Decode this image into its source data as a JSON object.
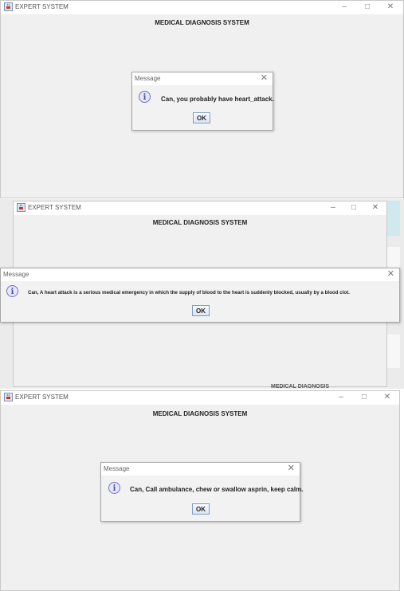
{
  "app": {
    "window_title": "EXPERT SYSTEM",
    "heading": "MEDICAL DIAGNOSIS SYSTEM",
    "controls": {
      "minimize": "–",
      "maximize": "□",
      "close": "✕"
    },
    "icon": "java-cup-icon"
  },
  "panels": [
    {
      "dialog_title": "Message",
      "message": "Can, you probably have heart_attack.",
      "ok_label": "OK",
      "icon": "info-icon"
    },
    {
      "dialog_title": "Message",
      "message": "Can, A heart attack is a serious medical emergency in which the supply of blood to the heart is suddenly blocked, usually by a blood clot.",
      "ok_label": "OK",
      "icon": "info-icon"
    },
    {
      "dialog_title": "Message",
      "message": "Can, Call ambulance, chew or swallow asprin, keep calm.",
      "ok_label": "OK",
      "icon": "info-icon"
    }
  ],
  "background_fragment": "MEDICAL DIAGNOSIS SYSTEM"
}
